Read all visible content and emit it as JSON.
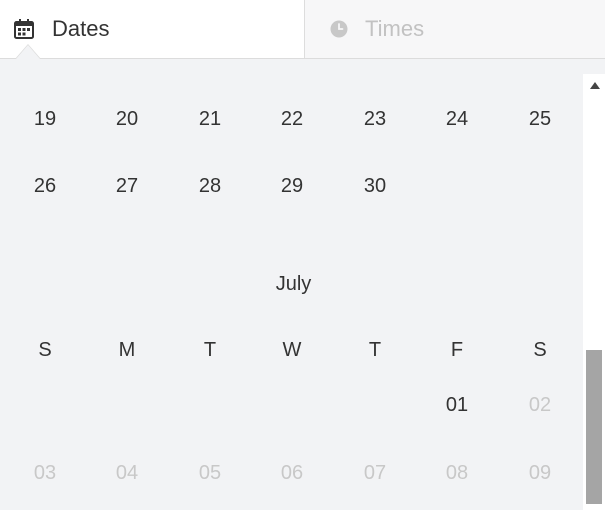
{
  "tabs": {
    "dates_label": "Dates",
    "times_label": "Times",
    "dates_icon": "calendar-icon",
    "times_icon": "clock-icon"
  },
  "calendar": {
    "previous_rows": [
      [
        "19",
        "20",
        "21",
        "22",
        "23",
        "24",
        "25"
      ],
      [
        "26",
        "27",
        "28",
        "29",
        "30",
        "",
        ""
      ]
    ],
    "month": {
      "title": "July",
      "weekdays": [
        "S",
        "M",
        "T",
        "W",
        "T",
        "F",
        "S"
      ],
      "rows": [
        [
          "",
          "",
          "",
          "",
          "",
          "01",
          "02"
        ],
        [
          "03",
          "04",
          "05",
          "06",
          "07",
          "08",
          "09"
        ]
      ]
    }
  },
  "colors": {
    "text": "#333333",
    "disabled_text": "#c8c8c8",
    "background": "#f2f3f5",
    "scroll_thumb": "#a5a5a5"
  }
}
